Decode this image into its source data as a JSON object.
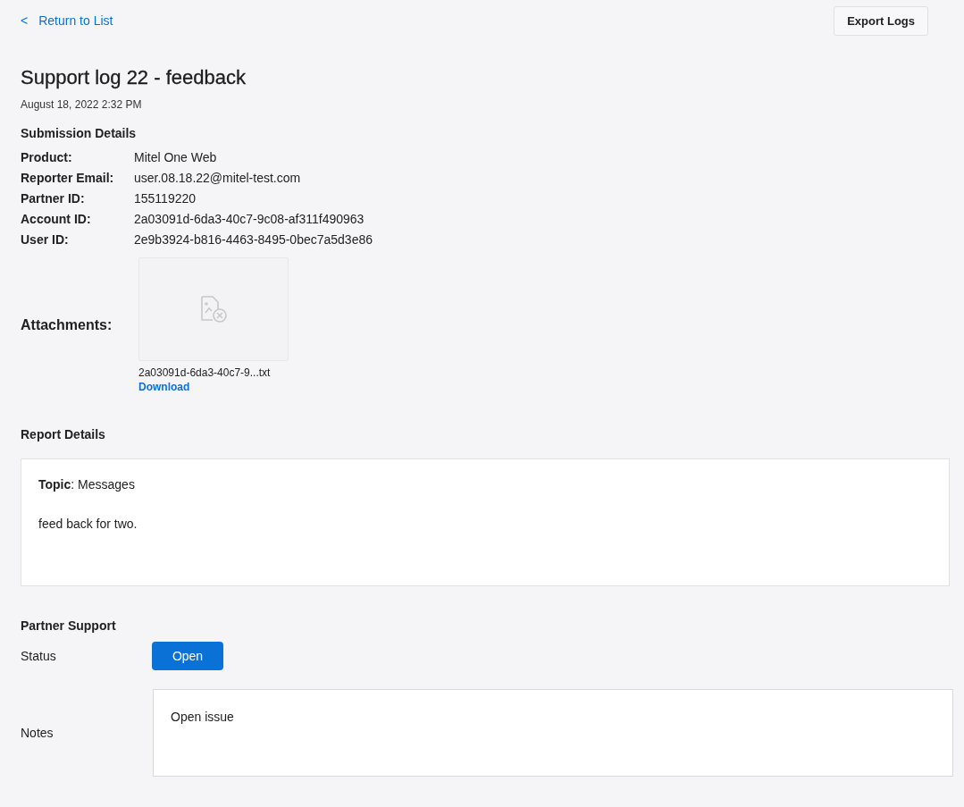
{
  "back_link": {
    "icon": "<",
    "label": "Return to List"
  },
  "export_button": "Export Logs",
  "title": "Support log 22 - feedback",
  "date": "August 18, 2022 2:32 PM",
  "submission": {
    "heading": "Submission Details",
    "fields": [
      {
        "label": "Product:",
        "value": "Mitel One Web"
      },
      {
        "label": "Reporter Email:",
        "value": "user.08.18.22@mitel-test.com"
      },
      {
        "label": "Partner ID:",
        "value": "155119220"
      },
      {
        "label": "Account ID:",
        "value": "2a03091d-6da3-40c7-9c08-af311f490963"
      },
      {
        "label": "User ID:",
        "value": "2e9b3924-b816-4463-8495-0bec7a5d3e86"
      }
    ],
    "attachments": {
      "label": "Attachments:",
      "files": [
        {
          "name": "2a03091d-6da3-40c7-9...txt",
          "link": "Download"
        }
      ]
    }
  },
  "report": {
    "heading": "Report Details",
    "topic": "**Topic**: Messages",
    "body": "feed back for two."
  },
  "partner_support": {
    "heading": "Partner Support",
    "status_label": "Status",
    "status": "Open",
    "notes_label": "Notes",
    "notes": "Open issue"
  }
}
